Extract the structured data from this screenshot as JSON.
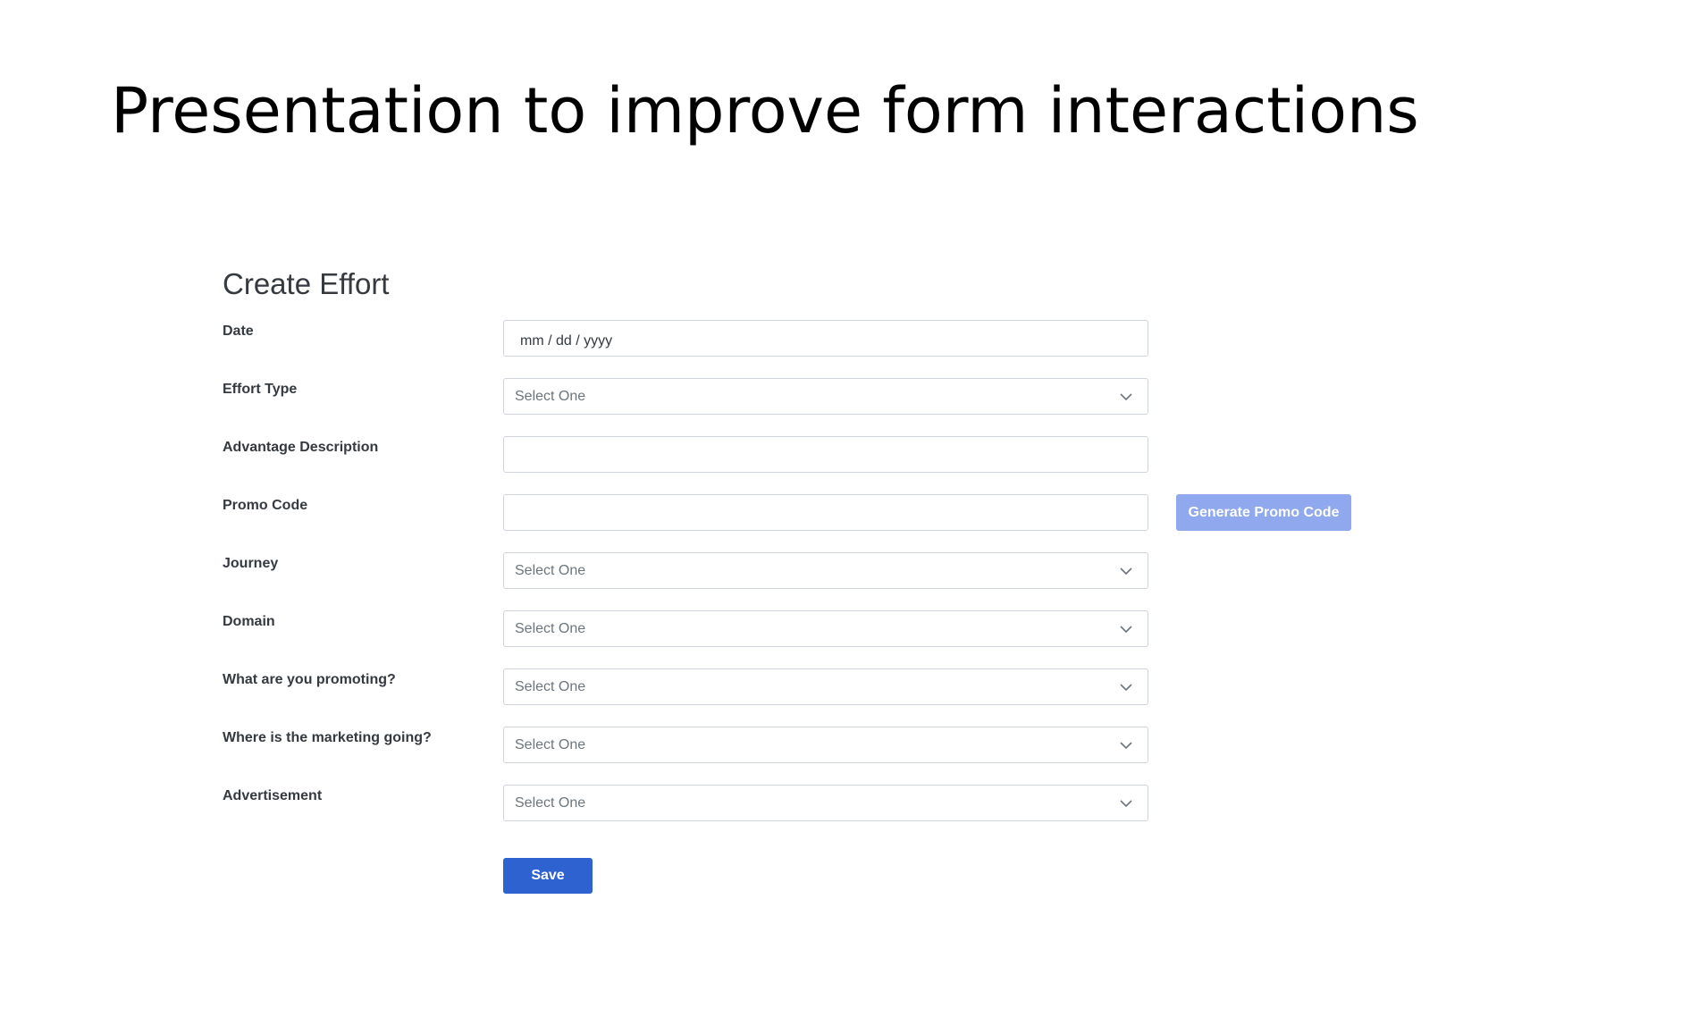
{
  "slide": {
    "title": "Presentation to improve form interactions"
  },
  "form": {
    "heading": "Create Effort",
    "fields": [
      {
        "label": "Date",
        "kind": "date",
        "value": "mm / dd / yyyy"
      },
      {
        "label": "Effort Type",
        "kind": "select",
        "value": "Select One"
      },
      {
        "label": "Advantage Description",
        "kind": "text",
        "value": ""
      },
      {
        "label": "Promo Code",
        "kind": "text",
        "value": ""
      },
      {
        "label": "Journey",
        "kind": "select",
        "value": "Select One"
      },
      {
        "label": "Domain",
        "kind": "select",
        "value": "Select One"
      },
      {
        "label": "What are you promoting?",
        "kind": "select",
        "value": "Select One"
      },
      {
        "label": "Where is the marketing going?",
        "kind": "select",
        "value": "Select One"
      },
      {
        "label": "Advertisement",
        "kind": "select",
        "value": "Select One"
      }
    ],
    "promo_button_label": "Generate Promo Code",
    "save_label": "Save",
    "select_icon": "chevron-down-icon"
  },
  "colors": {
    "primary": "#2f62d1",
    "primary_disabled": "#8fa8ee",
    "border": "#ced4da",
    "placeholder": "#6c757d",
    "label": "#343a40"
  }
}
